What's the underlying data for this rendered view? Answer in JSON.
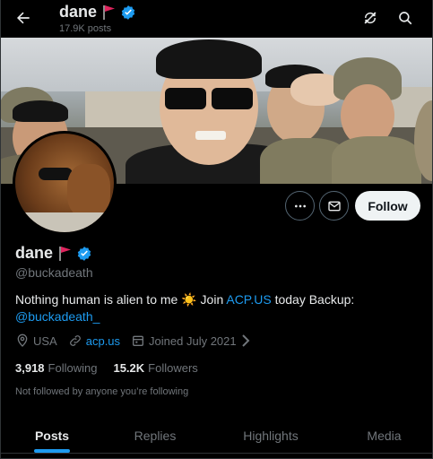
{
  "header": {
    "name": "dane",
    "posts_count": "17.9K posts"
  },
  "profile": {
    "display_name": "dane",
    "handle": "@buckadeath",
    "bio": {
      "text_before": "Nothing human is alien to me",
      "emoji": "☀️",
      "join": " Join ",
      "link1": "ACP.US",
      "text_after": " today Backup:",
      "link2": "@buckadeath_"
    },
    "location": "USA",
    "website": "acp.us",
    "joined": "Joined July 2021",
    "following_count": "3,918",
    "following_label": "Following",
    "followers_count": "15.2K",
    "followers_label": "Followers",
    "not_followed": "Not followed by anyone you’re following"
  },
  "actions": {
    "follow_label": "Follow"
  },
  "tabs": [
    {
      "label": "Posts",
      "active": true
    },
    {
      "label": "Replies",
      "active": false
    },
    {
      "label": "Highlights",
      "active": false
    },
    {
      "label": "Media",
      "active": false
    }
  ],
  "colors": {
    "accent": "#1d9bf0",
    "flag": "#e0245e",
    "background": "#000000",
    "muted": "#71767b"
  },
  "icons": [
    "back-arrow-icon",
    "red-flag-icon",
    "verified-badge-icon",
    "refresh-icon",
    "search-icon",
    "more-icon",
    "mail-icon",
    "location-icon",
    "link-icon",
    "calendar-icon",
    "chevron-right-icon"
  ]
}
